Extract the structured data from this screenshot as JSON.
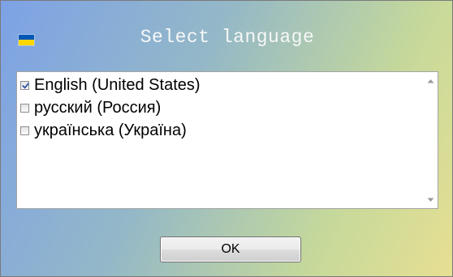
{
  "window": {
    "title": "Select language",
    "icon": "ukraine-flag-icon",
    "colors": {
      "gradient_start": "#7da2e6",
      "gradient_end": "#e7df93",
      "title_text": "#f7f7f7"
    }
  },
  "language_list": {
    "items": [
      {
        "label": "English (United States)",
        "checked": true
      },
      {
        "label": "русский (Россия)",
        "checked": false
      },
      {
        "label": "українська (Україна)",
        "checked": false
      }
    ],
    "scrollbar": {
      "up_icon": "scroll-up-arrow-icon",
      "down_icon": "scroll-down-arrow-icon"
    }
  },
  "buttons": {
    "ok_label": "OK"
  }
}
